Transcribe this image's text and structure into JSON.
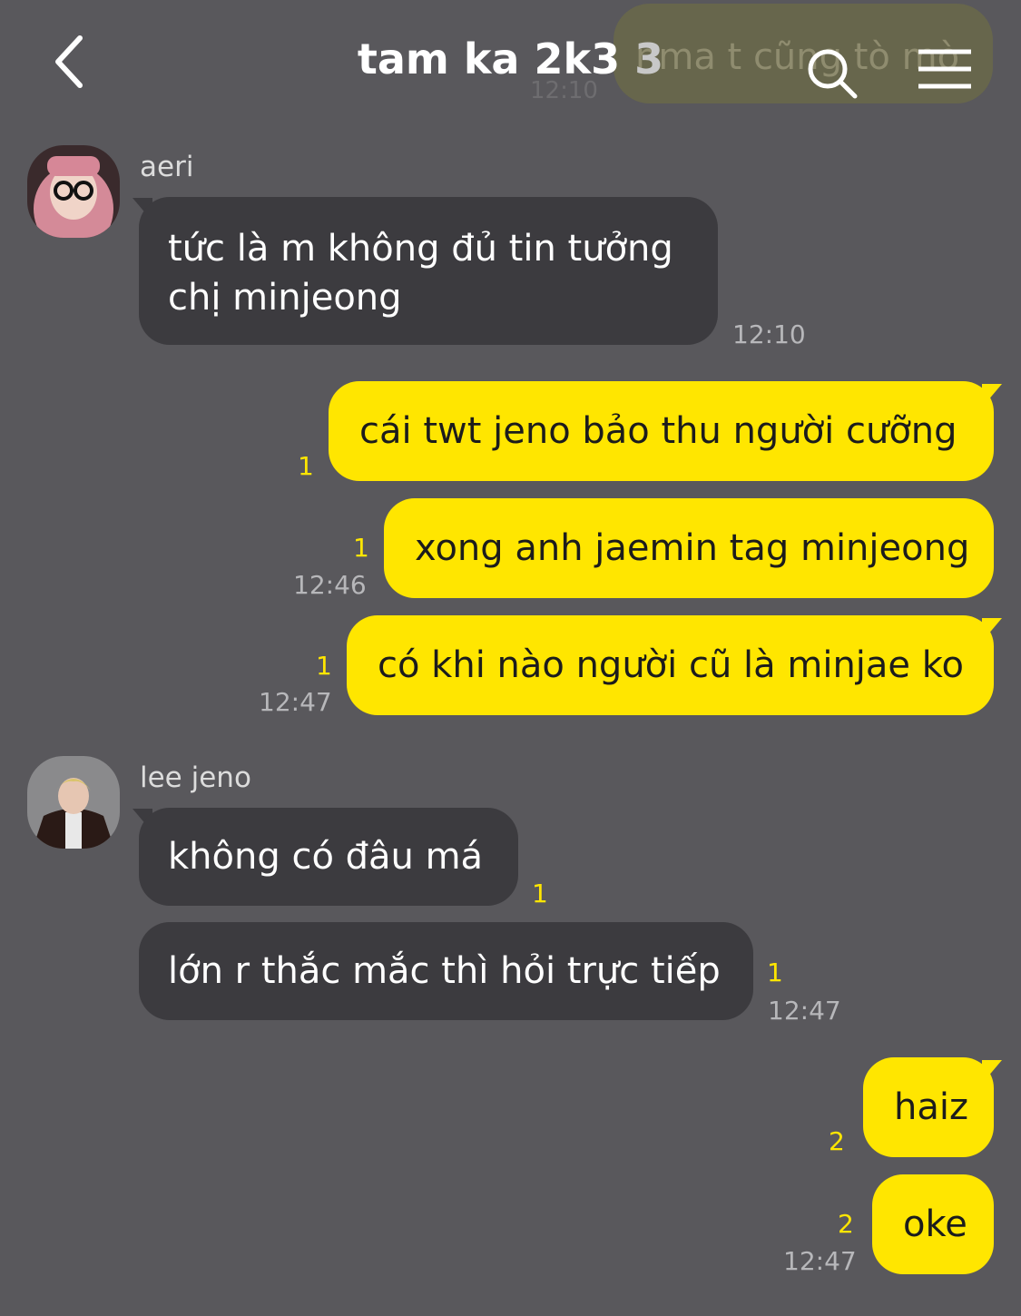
{
  "header": {
    "title": "tam ka 2k3",
    "member_count": "3",
    "back_icon": "chevron-left-icon",
    "search_icon": "search-icon",
    "menu_icon": "hamburger-menu-icon",
    "overlay_preview_text": "nma t cũng tò mò",
    "overlay_preview_time": "12:10"
  },
  "messages": [
    {
      "sender": "aeri",
      "text_line1": "tức là m không đủ tin tưởng",
      "text_line2": "chị minjeong",
      "time": "12:10"
    },
    {
      "sender": "me",
      "text": "cái twt jeno bảo thu người cưỡng",
      "unread": "1"
    },
    {
      "sender": "me",
      "text": "xong anh jaemin tag minjeong",
      "unread": "1",
      "time": "12:46"
    },
    {
      "sender": "me",
      "text": "có khi nào người cũ là minjae ko",
      "unread": "1",
      "time": "12:47"
    },
    {
      "sender": "lee jeno",
      "text": "không có đâu má",
      "unread": "1"
    },
    {
      "sender": "lee jeno",
      "text": "lớn r thắc mắc thì hỏi trực tiếp",
      "unread": "1",
      "time": "12:47"
    },
    {
      "sender": "me",
      "text": "haiz",
      "unread": "2"
    },
    {
      "sender": "me",
      "text": "oke",
      "unread": "2",
      "time": "12:47"
    }
  ],
  "colors": {
    "background": "#59585c",
    "incoming_bubble": "#3c3b3f",
    "outgoing_bubble": "#ffe600",
    "unread_count": "#ffe600"
  }
}
